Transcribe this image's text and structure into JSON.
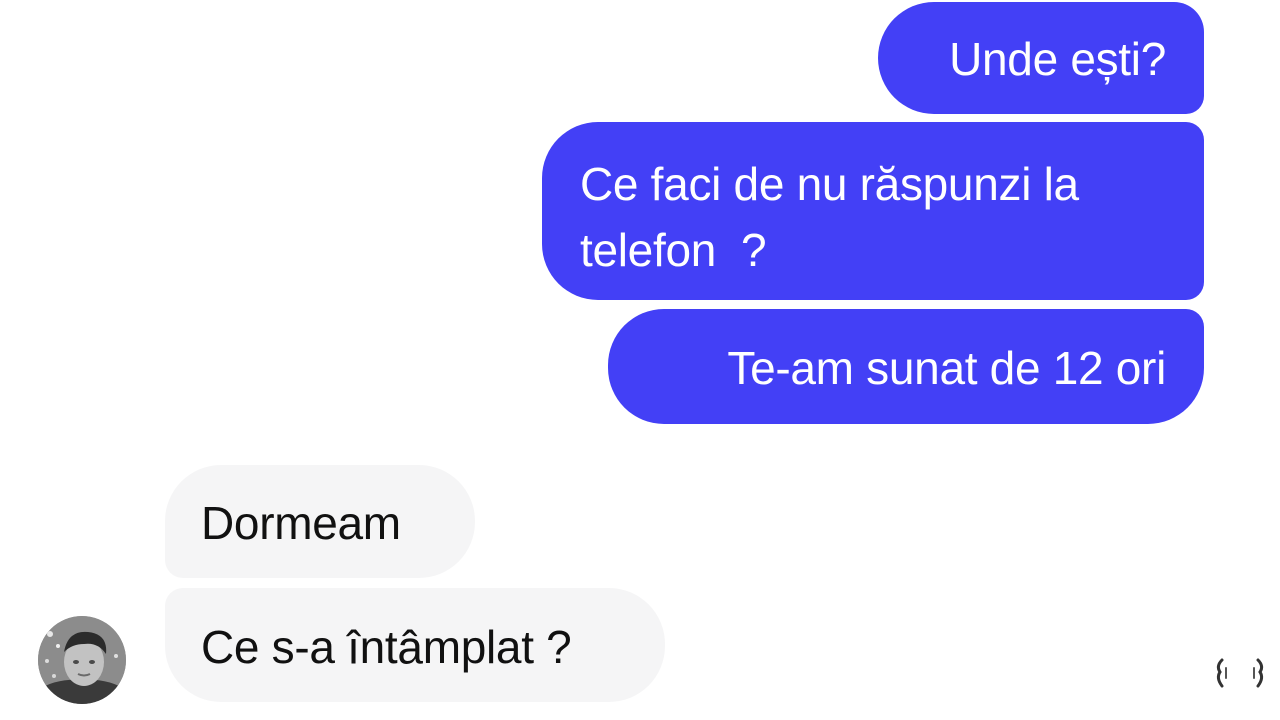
{
  "conversation": {
    "messages": [
      {
        "direction": "outgoing",
        "text": "Unde ești?"
      },
      {
        "direction": "outgoing",
        "text": "Ce faci de nu răspunzi la telefon  ?"
      },
      {
        "direction": "outgoing",
        "text": "Te-am sunat de 12 ori"
      },
      {
        "direction": "incoming",
        "text": "Dormeam"
      },
      {
        "direction": "incoming",
        "text": "Ce s-a întâmplat ?"
      }
    ],
    "contact": {
      "avatar_icon": "contact-avatar"
    },
    "read_indicator_icon": "seen-indicator-icon"
  },
  "colors": {
    "outgoing_bubble": "#4340f6",
    "incoming_bubble": "#f5f5f6",
    "outgoing_text": "#ffffff",
    "incoming_text": "#111111"
  }
}
